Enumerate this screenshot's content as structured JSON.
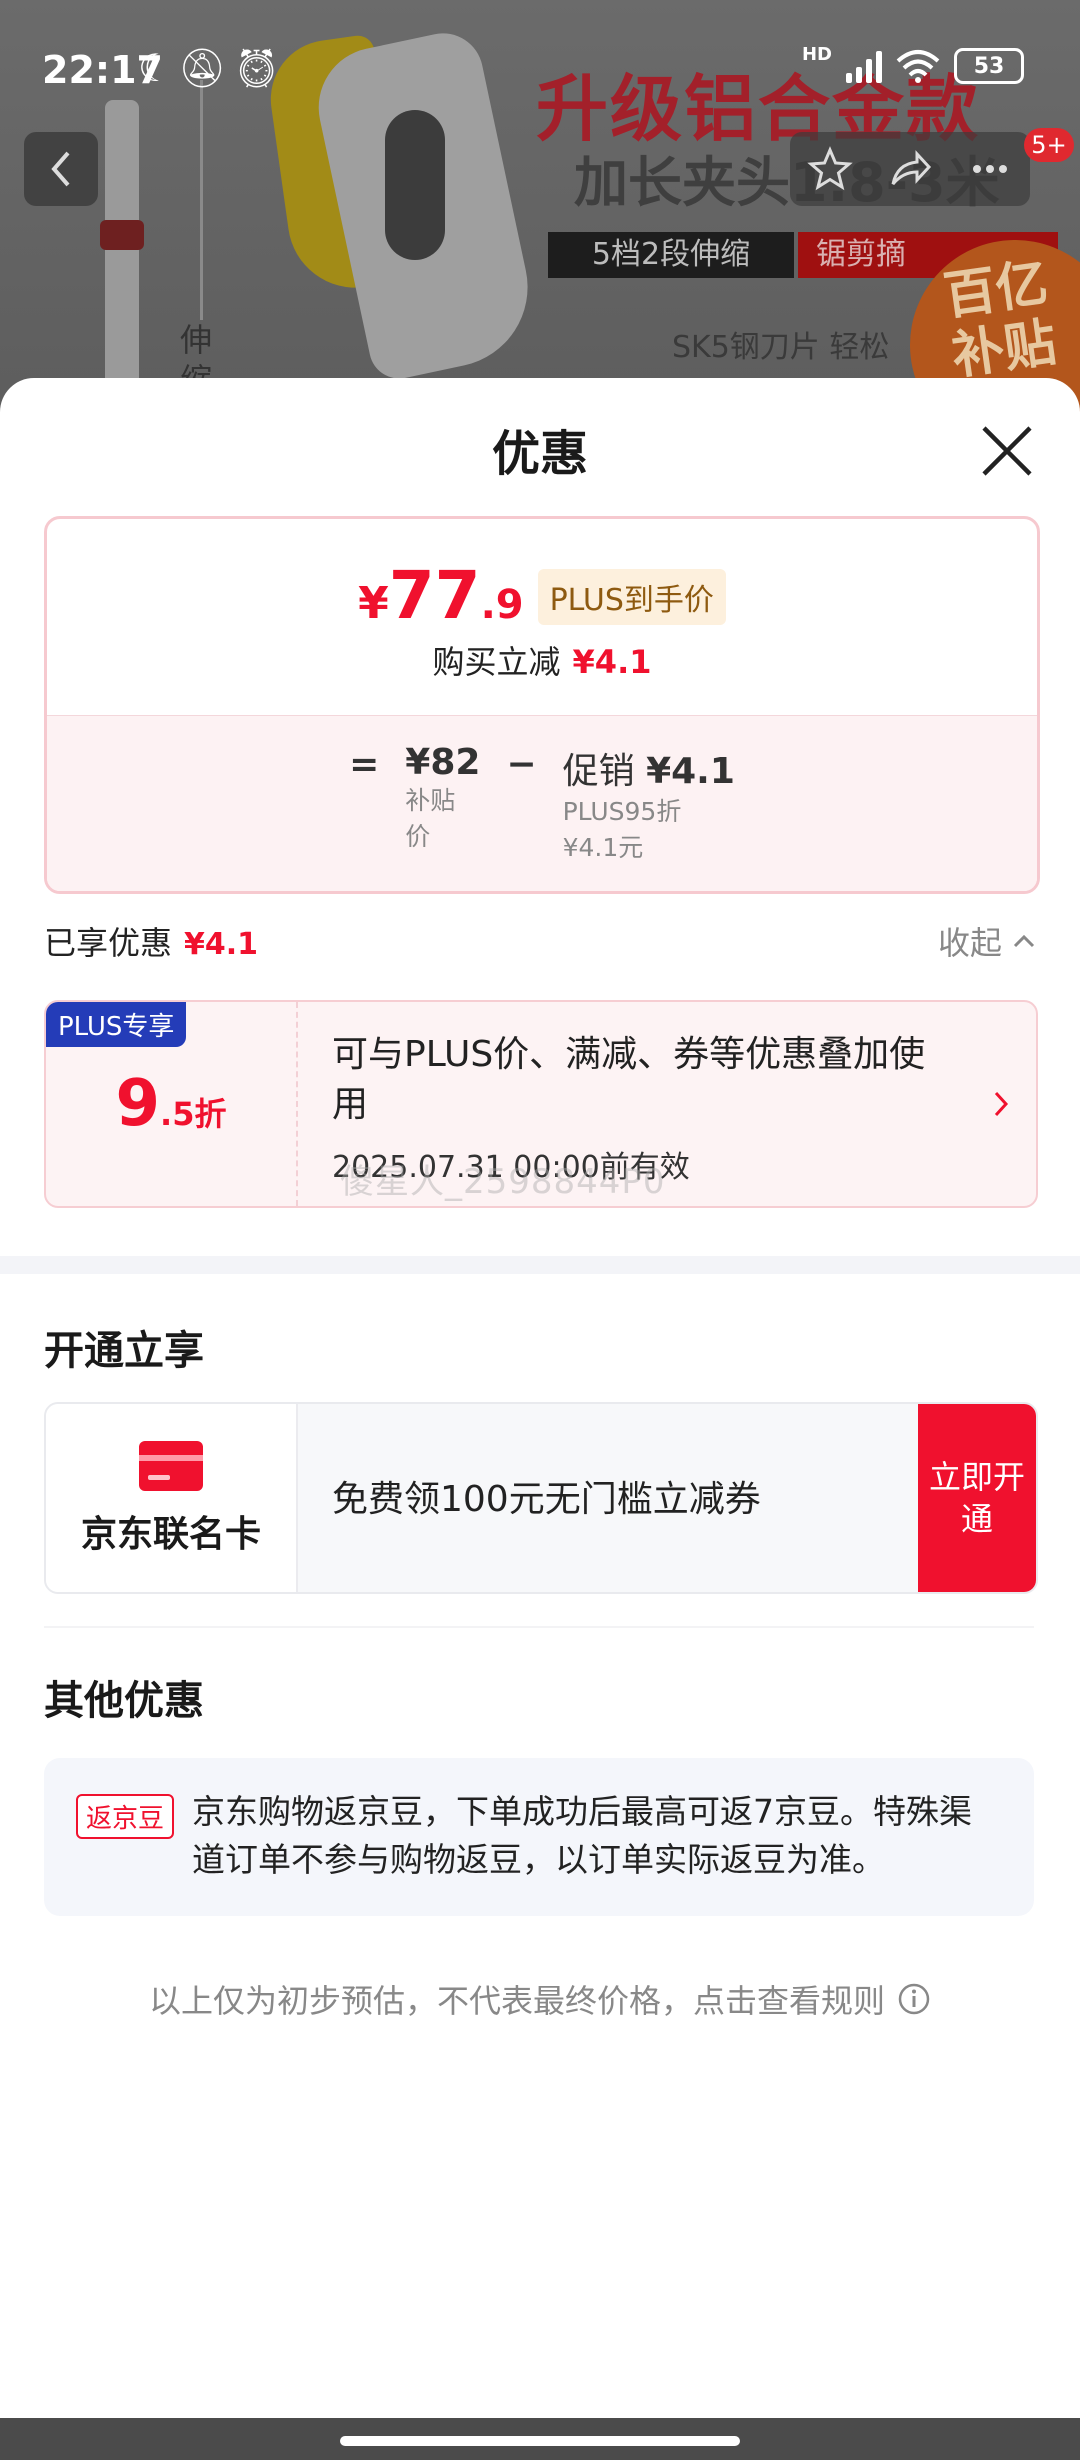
{
  "status_bar": {
    "time": "22:17",
    "network": "HD",
    "battery": "53"
  },
  "banner": {
    "title": "升级铝合金款",
    "subtitle": "加长夹头1.8-3米",
    "strip_left": "5档2段伸缩",
    "strip_right": "锯剪摘",
    "feature": "SK5钢刀片 轻松",
    "side_label": "伸缩",
    "badge_line1": "百亿",
    "badge_line2": "补贴",
    "notification_count": "5+"
  },
  "sheet": {
    "title": "优惠",
    "price": {
      "currency": "¥",
      "integer": "77",
      "decimal": ".9",
      "tag": "PLUS到手价"
    },
    "reduce": {
      "label": "购买立减",
      "value": "¥4.1"
    },
    "formula": {
      "equals": "=",
      "subsidy_price": "¥82",
      "subsidy_label_1": "补贴",
      "subsidy_label_2": "价",
      "minus": "−",
      "promo_label": "促销",
      "promo_value": "¥4.1",
      "promo_detail_1": "PLUS95折",
      "promo_detail_2": "¥4.1元"
    },
    "enjoyed": {
      "label": "已享优惠",
      "value": "¥4.1",
      "collapse": "收起"
    },
    "coupon": {
      "tag": "PLUS专享",
      "discount_num": "9",
      "discount_unit": ".5折",
      "text": "可与PLUS价、满减、券等优惠叠加使用",
      "validity": "2025.07.31 00:00前有效",
      "watermark": "傻星人_2598844P0"
    },
    "open_section": {
      "title": "开通立享",
      "card_name": "京东联名卡",
      "offer": "免费领100元无门槛立减券",
      "button": "立即开通"
    },
    "other_section": {
      "title": "其他优惠",
      "tag": "返京豆",
      "text": "京东购物返京豆，下单成功后最高可返7京豆。特殊渠道订单不参与购物返豆，以订单实际返豆为准。"
    },
    "footer_note": "以上仅为初步预估，不代表最终价格，点击查看规则"
  },
  "colors": {
    "accent": "#f0112e",
    "plus_blue": "#243cb8",
    "plus_gold": "#8e5a10"
  }
}
